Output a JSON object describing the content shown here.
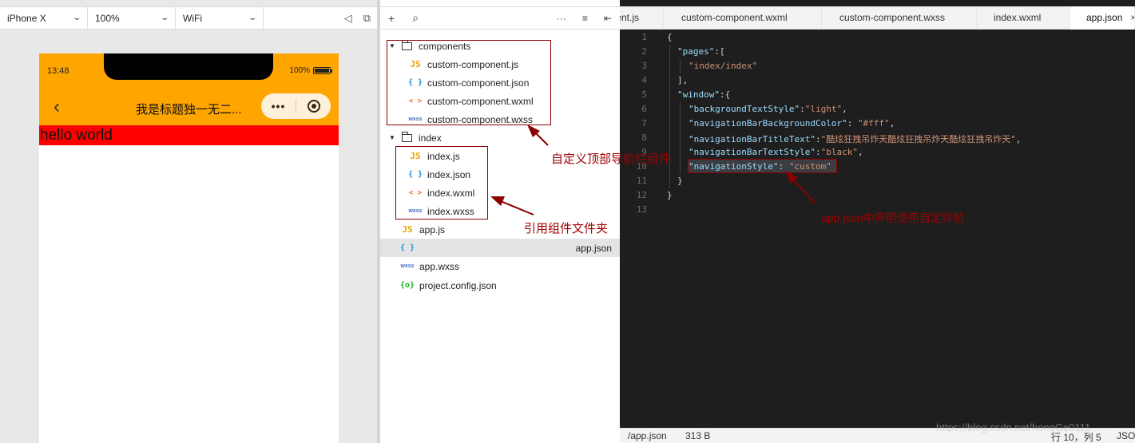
{
  "simulator": {
    "device": "iPhone X",
    "zoom": "100%",
    "network": "WiFi",
    "status_time": "13:48",
    "battery": "100%",
    "back_icon": "‹",
    "nav_title": "我是标题独一无二...",
    "capsule_more": "•••",
    "content_text": "hello world"
  },
  "toolbar_icons": [
    "plus-icon",
    "search-icon",
    "more-icon",
    "collapse-icon",
    "split-icon"
  ],
  "tree": {
    "components_folder": "components",
    "components_files": [
      {
        "type": "JS",
        "name": "custom-component.js"
      },
      {
        "type": "{ }",
        "name": "custom-component.json"
      },
      {
        "type": "< >",
        "name": "custom-component.wxml"
      },
      {
        "type": "wxss",
        "name": "custom-component.wxss"
      }
    ],
    "index_folder": "index",
    "index_files": [
      {
        "type": "JS",
        "name": "index.js"
      },
      {
        "type": "{ }",
        "name": "index.json"
      },
      {
        "type": "< >",
        "name": "index.wxml"
      },
      {
        "type": "wxss",
        "name": "index.wxss"
      }
    ],
    "root_files": [
      {
        "type": "JS",
        "name": "app.js"
      },
      {
        "type": "{ }",
        "name": "app.json"
      },
      {
        "type": "wxss",
        "name": "app.wxss"
      },
      {
        "type": "{o}",
        "name": "project.config.json"
      }
    ]
  },
  "annotations": {
    "custom_nav": "自定义顶部导航栏组件",
    "ref_folder": "引用组件文件夹",
    "app_json": "app.json中声明使用自定导航"
  },
  "editor": {
    "tabs": [
      "nent.js",
      "custom-component.wxml",
      "custom-component.wxss",
      "index.wxml",
      "app.json"
    ],
    "active_tab_close": "×",
    "line_numbers": [
      "1",
      "2",
      "3",
      "4",
      "5",
      "6",
      "7",
      "8",
      "9",
      "10",
      "11",
      "12",
      "13"
    ],
    "code": {
      "l1": "{",
      "l2_k": "\"pages\"",
      "l2_p": ":[",
      "l3": "\"index/index\"",
      "l4": "],",
      "l5_k": "\"window\"",
      "l5_p": ":{",
      "l6_k": "\"backgroundTextStyle\"",
      "l6_v": "\"light\"",
      "l7_k": "\"navigationBarBackgroundColor\"",
      "l7_v": "\"#fff\"",
      "l8_k": "\"navigationBarTitleText\"",
      "l8_v": "\"酷炫狂拽吊炸天酷炫狂拽吊炸天酷炫狂拽吊炸天\"",
      "l9_k": "\"navigationBarTextStyle\"",
      "l9_v": "\"black\"",
      "l10_k": "\"navigationStyle\"",
      "l10_v": "\"custom\"",
      "l11": "}",
      "l12": "}"
    },
    "status_path": "/app.json",
    "status_size": "313 B",
    "status_pos": "行 10，列 5",
    "status_lang": "JSON",
    "watermark": "https://blog.csdn.net/hongGe0111"
  }
}
